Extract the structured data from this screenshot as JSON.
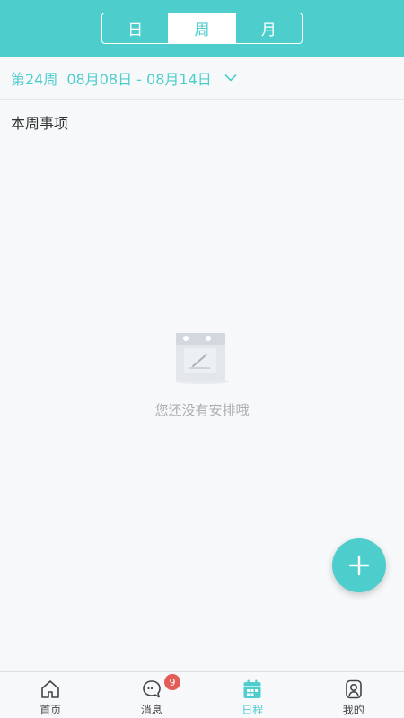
{
  "colors": {
    "accent": "#4ecdcd",
    "badge": "#e35d57"
  },
  "header": {
    "segments": [
      {
        "label": "日",
        "active": false
      },
      {
        "label": "周",
        "active": true
      },
      {
        "label": "月",
        "active": false
      }
    ]
  },
  "week": {
    "week_label": "第24周",
    "range": "08月08日 - 08月14日",
    "dropdown_icon": "chevron-down-icon"
  },
  "section": {
    "title": "本周事项"
  },
  "empty_state": {
    "icon": "calendar-edit-icon",
    "message": "您还没有安排哦"
  },
  "fab": {
    "icon": "plus-icon"
  },
  "tabbar": {
    "tabs": [
      {
        "label": "首页",
        "icon": "home-icon",
        "active": false
      },
      {
        "label": "消息",
        "icon": "message-icon",
        "active": false,
        "badge": "9"
      },
      {
        "label": "日程",
        "icon": "calendar-icon",
        "active": true
      },
      {
        "label": "我的",
        "icon": "profile-icon",
        "active": false
      }
    ]
  }
}
